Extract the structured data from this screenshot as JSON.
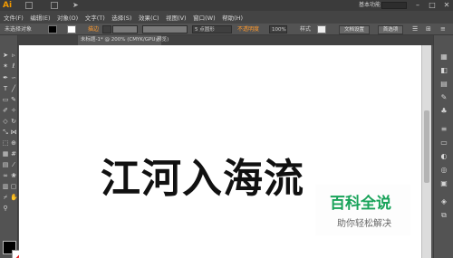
{
  "titlebar": {
    "logo": "Ai",
    "workspace": "基本功能",
    "min": "–",
    "max": "□",
    "close": "✕"
  },
  "menu": [
    "文件(F)",
    "编辑(E)",
    "对象(O)",
    "文字(T)",
    "选择(S)",
    "效果(C)",
    "视图(V)",
    "窗口(W)",
    "帮助(H)"
  ],
  "control": {
    "selection": "未选择对象",
    "stroke_label": "描边",
    "stroke_value": "",
    "brush": "5 点圆形",
    "opacity_label": "不透明度",
    "opacity_value": "100%",
    "style_label": "样式",
    "doc_setup": "文档设置",
    "prefs": "首选项"
  },
  "tab": {
    "label": "未标题-1* @ 200% (CMYK/GPU 预览)",
    "close": "×"
  },
  "canvas": {
    "artwork_text": "江河入海流"
  },
  "watermark": {
    "title": "百科全说",
    "subtitle": "助你轻松解决"
  },
  "colors": {
    "accent": "#f39a00",
    "watermark_green": "#19a35a",
    "fill": "#000000",
    "stroke_none": "#e02020"
  },
  "tools": [
    "selection-tool",
    "direct-selection-tool",
    "magic-wand-tool",
    "lasso-tool",
    "pen-tool",
    "curvature-tool",
    "type-tool",
    "line-tool",
    "rectangle-tool",
    "paintbrush-tool",
    "pencil-tool",
    "shaper-tool",
    "eraser-tool",
    "rotate-tool",
    "scale-tool",
    "width-tool",
    "free-transform-tool",
    "shape-builder-tool",
    "perspective-grid-tool",
    "mesh-tool",
    "gradient-tool",
    "eyedropper-tool",
    "blend-tool",
    "symbol-sprayer-tool",
    "column-graph-tool",
    "artboard-tool",
    "slice-tool",
    "hand-tool",
    "zoom-tool"
  ]
}
